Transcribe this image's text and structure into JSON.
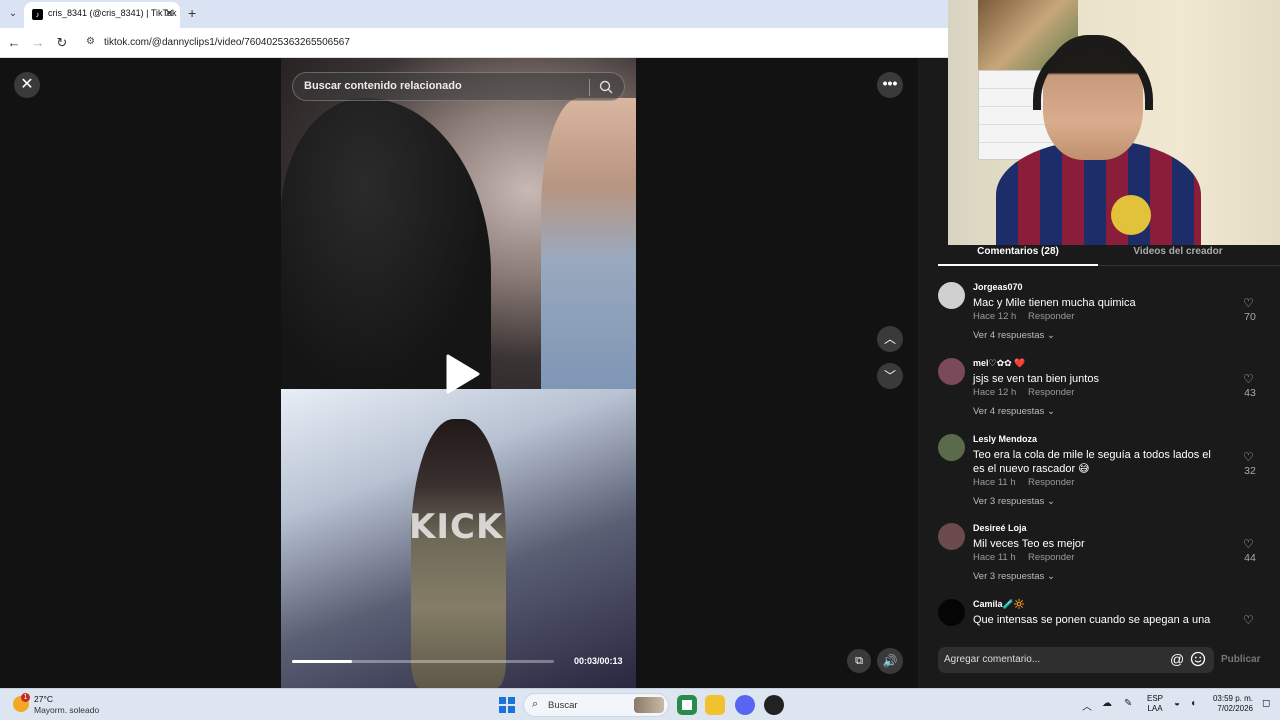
{
  "browser": {
    "tab_title": "cris_8341 (@cris_8341) | TikTok",
    "tab_favicon": "tiktok-icon",
    "url": "tiktok.com/@dannyclips1/video/7604025363265506567"
  },
  "player": {
    "search_placeholder": "Buscar contenido relacionado",
    "overlay_text": "KICK",
    "time": "00:03/00:13",
    "progress": 0.23
  },
  "panel": {
    "tab_comments": "Comentarios (28)",
    "tab_creator": "Videos del creador",
    "reply_label": "Responder",
    "add_comment_placeholder": "Agregar comentario...",
    "at_symbol": "@",
    "publish_label": "Publicar"
  },
  "comments": [
    {
      "user": "Jorgeas070",
      "text": "Mac y Mile tienen mucha quimica",
      "time": "Hace 12 h",
      "replies": "Ver 4 respuestas",
      "likes": "70",
      "avatar_color": "#d0d0d0"
    },
    {
      "user": "mel♡✿✿ ❤️",
      "text": "jsjs se ven tan bien juntos",
      "time": "Hace 12 h",
      "replies": "Ver 4 respuestas",
      "likes": "43",
      "avatar_color": "#7a4a5a"
    },
    {
      "user": "Lesly Mendoza",
      "text": "Teo era la cola de mile le seguía a todos lados el es el nuevo rascador 😅",
      "time": "Hace 11 h",
      "replies": "Ver 3 respuestas",
      "likes": "32",
      "avatar_color": "#5a6a4a"
    },
    {
      "user": "Desireé Loja",
      "text": "Mil veces Teo es mejor",
      "time": "Hace 11 h",
      "replies": "Ver 3 respuestas",
      "likes": "44",
      "avatar_color": "#6a4a4a"
    },
    {
      "user": "Camila🧪🔆",
      "text": "Que intensas se ponen cuando se apegan a una",
      "time": "",
      "replies": "",
      "likes": "",
      "avatar_color": "#050505"
    }
  ],
  "taskbar": {
    "temp": "27°C",
    "weather": "Mayorm. soleado",
    "weather_badge": "1",
    "search": "Buscar",
    "lang_line1": "ESP",
    "lang_line2": "LAA",
    "time": "03:59 p. m.",
    "date": "7/02/2026"
  }
}
